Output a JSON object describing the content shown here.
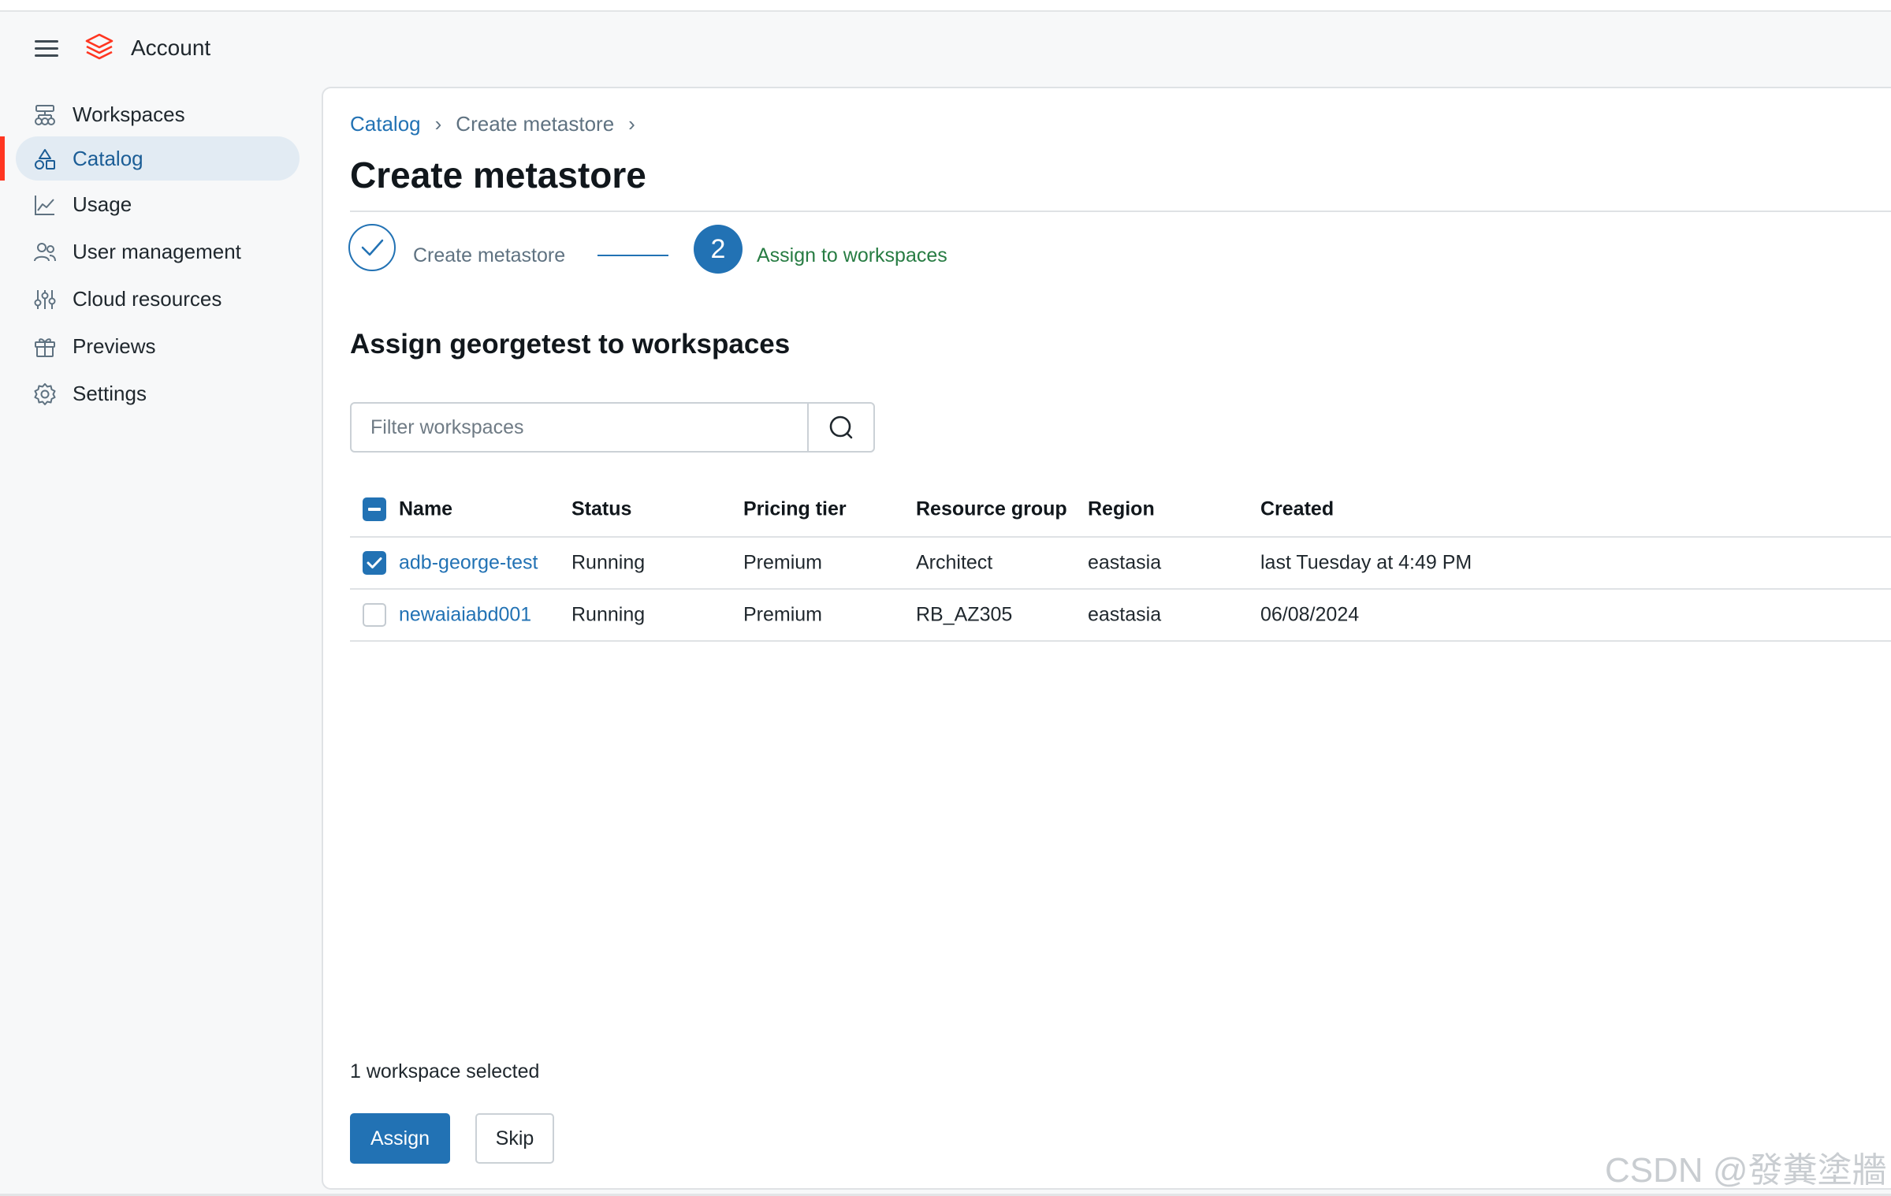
{
  "header": {
    "title": "Account",
    "logo_color": "#ff3621"
  },
  "sidebar": {
    "items": [
      {
        "label": "Workspaces",
        "icon": "workspaces-icon",
        "active": false
      },
      {
        "label": "Catalog",
        "icon": "catalog-icon",
        "active": true
      },
      {
        "label": "Usage",
        "icon": "usage-chart-icon",
        "active": false
      },
      {
        "label": "User management",
        "icon": "users-icon",
        "active": false
      },
      {
        "label": "Cloud resources",
        "icon": "sliders-icon",
        "active": false
      },
      {
        "label": "Previews",
        "icon": "gift-icon",
        "active": false
      },
      {
        "label": "Settings",
        "icon": "gear-icon",
        "active": false
      }
    ]
  },
  "breadcrumb": {
    "root": "Catalog",
    "current": "Create metastore",
    "separator": "›"
  },
  "page": {
    "title": "Create metastore"
  },
  "steps": [
    {
      "label": "Create metastore",
      "state": "completed"
    },
    {
      "number": "2",
      "label": "Assign to workspaces",
      "state": "current"
    }
  ],
  "section": {
    "title": "Assign georgetest to workspaces"
  },
  "filter": {
    "placeholder": "Filter workspaces",
    "value": ""
  },
  "table": {
    "columns": [
      "Name",
      "Status",
      "Pricing tier",
      "Resource group",
      "Region",
      "Created"
    ],
    "header_checkbox": "indeterminate",
    "rows": [
      {
        "checked": true,
        "name": "adb-george-test",
        "status": "Running",
        "pricing_tier": "Premium",
        "resource_group": "Architect",
        "region": "eastasia",
        "created": "last Tuesday at 4:49 PM"
      },
      {
        "checked": false,
        "name": "newaiaiabd001",
        "status": "Running",
        "pricing_tier": "Premium",
        "resource_group": "RB_AZ305",
        "region": "eastasia",
        "created": "06/08/2024"
      }
    ]
  },
  "footer": {
    "selected_text": "1 workspace selected",
    "assign_label": "Assign",
    "skip_label": "Skip"
  },
  "watermark": "CSDN @發糞塗牆",
  "colors": {
    "primary": "#2272b4",
    "success": "#277c43",
    "active_bg": "#e2ebf3",
    "active_bar": "#ff3621"
  }
}
